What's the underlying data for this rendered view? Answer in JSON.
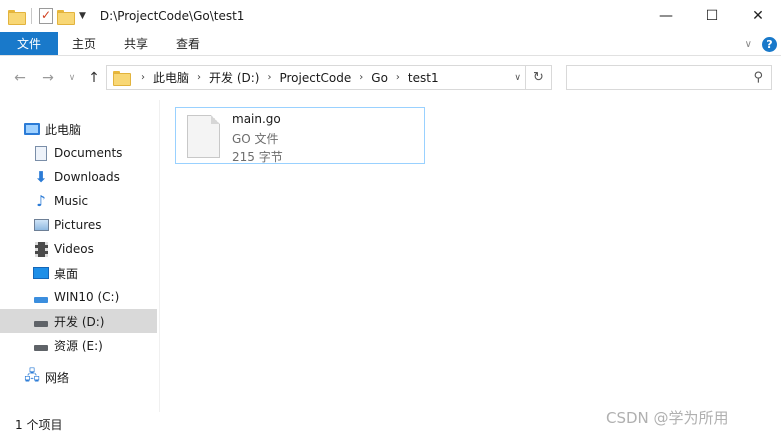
{
  "titlebar": {
    "path": "D:\\ProjectCode\\Go\\test1",
    "controls": {
      "minimize": "—",
      "maximize": "☐",
      "close": "✕"
    }
  },
  "ribbon": {
    "tabs": [
      {
        "label": "文件",
        "active": true
      },
      {
        "label": "主页"
      },
      {
        "label": "共享"
      },
      {
        "label": "查看"
      }
    ],
    "help": "?"
  },
  "address": {
    "crumbs": [
      "此电脑",
      "开发 (D:)",
      "ProjectCode",
      "Go",
      "test1"
    ]
  },
  "nav": {
    "items": [
      {
        "label": "此电脑",
        "icon": "computer-icon"
      },
      {
        "label": "Documents",
        "icon": "documents-icon"
      },
      {
        "label": "Downloads",
        "icon": "download-icon"
      },
      {
        "label": "Music",
        "icon": "music-icon"
      },
      {
        "label": "Pictures",
        "icon": "pictures-icon"
      },
      {
        "label": "Videos",
        "icon": "videos-icon"
      },
      {
        "label": "桌面",
        "icon": "desktop-icon"
      },
      {
        "label": "WIN10 (C:)",
        "icon": "system-drive-icon"
      },
      {
        "label": "开发 (D:)",
        "icon": "drive-icon",
        "selected": true
      },
      {
        "label": "资源 (E:)",
        "icon": "drive-icon"
      },
      {
        "label": "网络",
        "icon": "network-icon"
      }
    ]
  },
  "file": {
    "name": "main.go",
    "type": "GO 文件",
    "size": "215 字节"
  },
  "status": {
    "count": "1 个项目"
  },
  "watermark": "CSDN @学为所用",
  "colors": {
    "accent": "#1979ca",
    "selection_border": "#99d1ff",
    "nav_selected": "#d9d9d9"
  }
}
